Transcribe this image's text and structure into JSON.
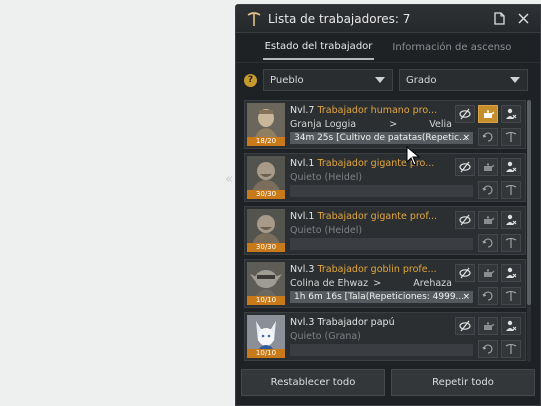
{
  "window": {
    "title": "Lista de trabajadores: 7"
  },
  "tabs": [
    {
      "label": "Estado del trabajador",
      "active": true
    },
    {
      "label": "Información de ascenso",
      "active": false
    }
  ],
  "filters": {
    "help_label": "?",
    "town": "Pueblo",
    "grade": "Grado"
  },
  "workers": [
    {
      "level": "Nvl.7",
      "name": "Trabajador humano pro...",
      "location": "Granja Loggia",
      "arrow": ">",
      "destination": "Velia",
      "task": "34m 25s [Cultivo de patatas(Repetic...",
      "task_close": "×",
      "stamina": "18/20",
      "portrait": "human",
      "busy": true,
      "highlight_second_icon": true
    },
    {
      "level": "Nvl.1",
      "name": "Trabajador gigante pro...",
      "location": "Quieto (Heidel)",
      "arrow": "",
      "destination": "",
      "task": "",
      "task_close": "",
      "stamina": "30/30",
      "portrait": "giant",
      "busy": false,
      "highlight_second_icon": false
    },
    {
      "level": "Nvl.1",
      "name": "Trabajador gigante prof...",
      "location": "Quieto (Heidel)",
      "arrow": "",
      "destination": "",
      "task": "",
      "task_close": "",
      "stamina": "30/30",
      "portrait": "giant",
      "busy": false,
      "highlight_second_icon": false
    },
    {
      "level": "Nvl.3",
      "name": "Trabajador goblin profe...",
      "location": "Colina de Ehwaz",
      "arrow": ">",
      "destination": "Arehaza",
      "task": "1h 6m 16s [Tala(Repeticiones: 4999...",
      "task_close": "×",
      "stamina": "10/10",
      "portrait": "goblin",
      "busy": true,
      "highlight_second_icon": false
    },
    {
      "level": "Nvl.3",
      "name": "Trabajador papú",
      "location": "Quieto (Grana)",
      "arrow": "",
      "destination": "",
      "task": "",
      "task_close": "",
      "stamina": "10/10",
      "portrait": "papu",
      "busy": false,
      "highlight_second_icon": false,
      "plain_name": true
    }
  ],
  "footer": {
    "reset_all": "Restablecer todo",
    "repeat_all": "Repetir todo"
  },
  "colors": {
    "accent": "#e3a73a",
    "stamina_bar": "#c87a1a",
    "panel_bg": "#1f2225"
  },
  "icons": {
    "title": "pickaxe-icon",
    "edit": "document-icon",
    "close": "close-icon"
  }
}
